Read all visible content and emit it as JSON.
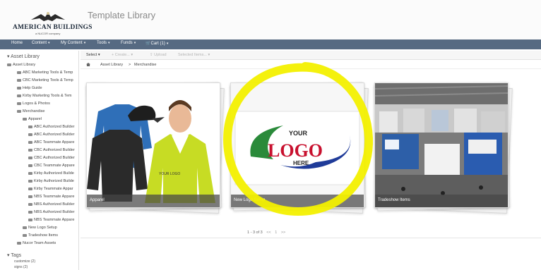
{
  "header": {
    "logo_text": "AMERICAN BUILDINGS",
    "logo_sub": "a NUCOR company",
    "page_title": "Template Library"
  },
  "nav": {
    "items": [
      "Home",
      "Content",
      "My Content",
      "Tools",
      "Funds",
      "Cart (1)"
    ]
  },
  "sidebar": {
    "heading": "Asset Library",
    "items": [
      "Asset Library",
      "ABC Marketing Tools & Temp",
      "CBC Marketing Tools & Temp",
      "Help Guide",
      "Kirby Marketing Tools & Tem",
      "Logos & Photos",
      "Merchandise",
      "Apparel",
      "ABC Authorized Builder",
      "ABC Authorized Builder",
      "ABC Teammate Appare",
      "CBC Authorized Builder",
      "CBC Authorized Builder",
      "CBC Teammate Appare",
      "Kirby Authorized Builde",
      "Kirby Authorized Builde",
      "Kirby Teammate Appar",
      "NBS Teammate Appare",
      "NBS Authorized Builder",
      "NBS Authorized Builder",
      "NBS Teammate Appare",
      "New Logo Setup",
      "Tradeshow Items",
      "Nucor Team Assets"
    ],
    "tags_heading": "Tags",
    "tags": [
      "customize (2)",
      "signs (2)"
    ]
  },
  "toolbar": {
    "select": "Select",
    "create": "+ Create...",
    "upload": "Upload",
    "selected": "Selected Items..."
  },
  "breadcrumb": [
    "Asset Library",
    ">",
    "Merchandise"
  ],
  "cards": [
    {
      "label": "Apparel"
    },
    {
      "label": "New Logo Setup"
    },
    {
      "label": "Tradeshow Items"
    }
  ],
  "logo_card": {
    "your": "YOUR",
    "logo": "LOGO",
    "here": "HERE"
  },
  "pager": {
    "text": "1 - 3 of 3",
    "prev": "<<",
    "page": "1",
    "next": ">>"
  },
  "colors": {
    "navbar": "#566a82",
    "highlight": "#f3f000",
    "logo_red": "#c8102e",
    "logo_blue": "#1f3b99",
    "logo_green": "#2a8a3a"
  }
}
